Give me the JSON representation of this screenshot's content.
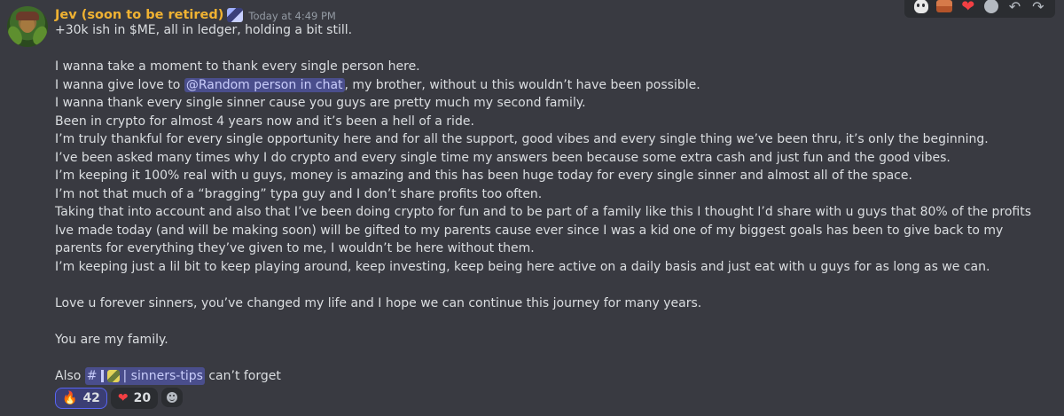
{
  "message": {
    "username": "Jev (soon to be retired)",
    "timestamp": "Today at 4:49 PM",
    "lines": [
      "+30k ish in $ME, all in ledger, holding a bit still."
    ],
    "paragraph1": [
      "I wanna take a moment to thank every single person here."
    ],
    "line_mention_before": "I wanna give love to ",
    "mention": "@Random person in chat",
    "line_mention_after": ", my brother, without u this wouldn’t have been possible.",
    "paragraph2": [
      "I wanna thank every single sinner cause you guys are pretty much my second family.",
      "Been in crypto for almost 4 years now and it’s been a hell of a ride.",
      "I’m truly thankful for every single opportunity here and for all the support, good vibes and every single thing we’ve been thru, it’s only the beginning.",
      "I’ve been asked many times why I do crypto and every single time my answers been because some extra cash and just fun and the good vibes.",
      "I’m keeping it 100% real with u guys, money is amazing and this has been huge today for every single sinner and almost all of the space.",
      "I’m not that much of a “bragging” typa guy and I don’t share profits too often.",
      "Taking that into account and also that I’ve been doing crypto for fun and to be part of a family like this I thought I’d share with u guys that 80% of the profits Ive made today (and will be making soon) will be gifted to my parents cause ever since I was a kid one of my biggest goals has been to give back to my parents for everything they’ve given to me, I wouldn’t be here without them.",
      "I’m keeping just a lil bit to keep playing around, keep investing, keep being here active on a daily basis and just eat with u guys for as long as we can."
    ],
    "love_line": "Love u forever sinners, you’ve changed my life and I hope we can continue this journey for many years.",
    "family_line": "You are my family.",
    "also_before": "Also ",
    "channel_hash": "#",
    "channel_name": "| sinners-tips",
    "also_after": " can’t forget"
  },
  "reactions": [
    {
      "emoji": "🔥",
      "count": "42",
      "active": true
    },
    {
      "emoji": "❤",
      "count": "20",
      "active": false
    }
  ],
  "hover_actions": [
    "skull-emoji",
    "brick-emoji",
    "heart-emoji",
    "add-reaction",
    "reply",
    "more"
  ],
  "colors": {
    "background": "#393a41",
    "username": "#f0b232",
    "mention_bg": "#4a4e8c",
    "text": "#dbdee1"
  }
}
